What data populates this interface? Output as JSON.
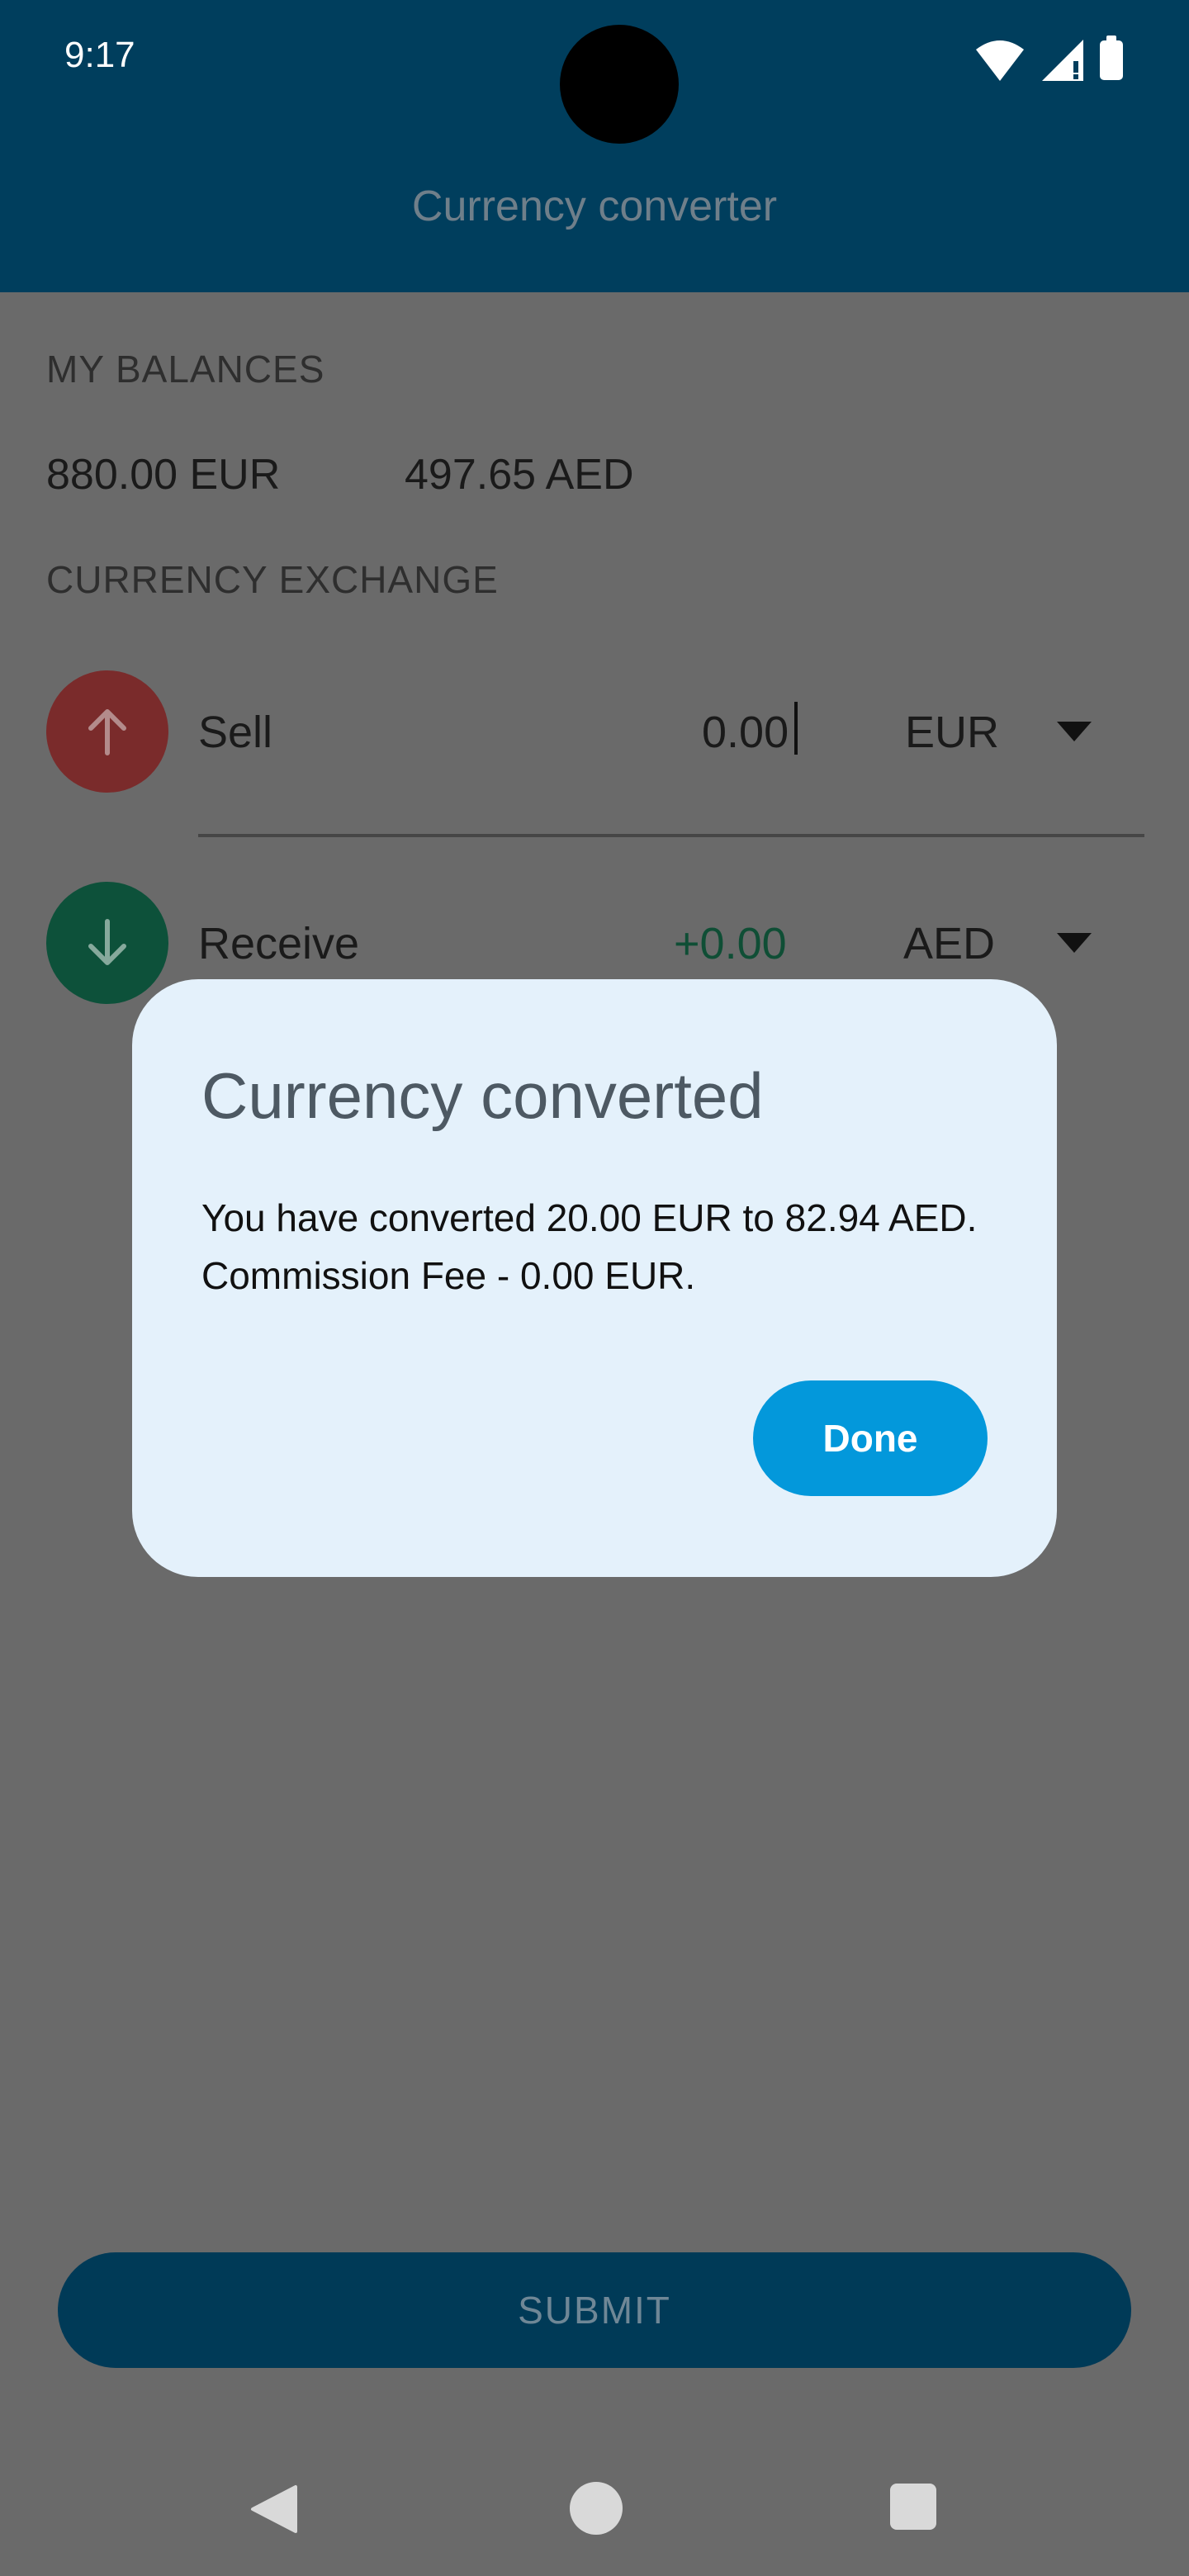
{
  "status_bar": {
    "time": "9:17",
    "icons": [
      "wifi-icon",
      "cell-signal-icon",
      "battery-icon"
    ]
  },
  "app_bar": {
    "title": "Currency converter"
  },
  "balances": {
    "section_title": "MY BALANCES",
    "items": [
      "880.00 EUR",
      "497.65 AED"
    ]
  },
  "exchange": {
    "section_title": "CURRENCY EXCHANGE",
    "sell": {
      "label": "Sell",
      "amount": "0.00",
      "currency": "EUR",
      "icon": "arrow-up-icon",
      "color": "#7a2b2b"
    },
    "receive": {
      "label": "Receive",
      "amount": "+0.00",
      "currency": "AED",
      "icon": "arrow-down-icon",
      "color": "#0d513a"
    }
  },
  "submit": {
    "label": "SUBMIT"
  },
  "dialog": {
    "title": "Currency converted",
    "message": "You have converted 20.00 EUR to 82.94 AED. Commission Fee - 0.00 EUR.",
    "done_label": "Done",
    "accent_color": "#0398db"
  },
  "nav_bar": {
    "icons": [
      "back-icon",
      "home-icon",
      "recents-icon"
    ]
  }
}
